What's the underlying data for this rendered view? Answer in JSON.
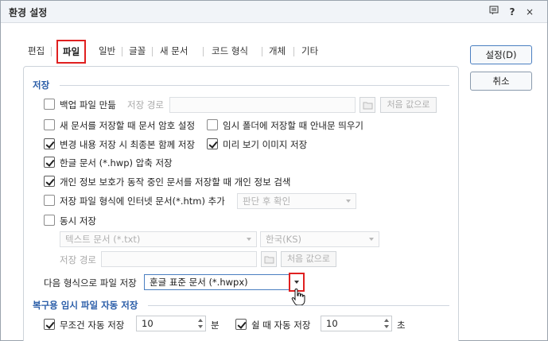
{
  "window": {
    "title": "환경 설정",
    "icons": [
      "help-panel-icon",
      "question-icon",
      "close-icon"
    ],
    "q": "?",
    "x": "×"
  },
  "tabs": [
    "편집",
    "파일",
    "일반",
    "글꼴",
    "새 문서",
    "코드 형식",
    "개체",
    "기타"
  ],
  "buttons": {
    "ok": "설정(D)",
    "cancel": "취소"
  },
  "save": {
    "group": "저장",
    "backup": "백업 파일 만듦",
    "save_path_label": "저장 경로",
    "default_value": "처음 값으로",
    "pwd_new_doc": "새 문서를 저장할 때 문서 암호 설정",
    "temp_folder_notice": "임시 폴더에 저장할 때 안내문 띄우기",
    "save_changes_only": "변경 내용 저장 시 최종본 함께 저장",
    "save_preview": "미리 보기 이미지 저장",
    "hwp_compress": "한글 문서 (*.hwp) 압축 저장",
    "privacy_check": "개인 정보 보호가 동작 중인 문서를 저장할 때 개인 정보 검색",
    "add_web_format": "저장 파일 형식에 인터넷 문서(*.htm) 추가",
    "add_web_format_select": "판단 후 확인",
    "sync_save": "동시 저장",
    "sync_format": "텍스트 문서 (*.txt)",
    "sync_encoding": "한국(KS)",
    "sync_path_label": "저장 경로",
    "sync_default": "처음 값으로",
    "save_as_label": "다음 형식으로 파일 저장",
    "save_as_value": "훈글 표준 문서 (*.hwpx)"
  },
  "recovery": {
    "group": "복구용 임시 파일 자동 저장",
    "always_label": "무조건 자동 저장",
    "always_value": "10",
    "always_unit": "분",
    "idle_label": "쉴 때 자동 저장",
    "idle_value": "10",
    "idle_unit": "초"
  },
  "checks": {
    "backup": false,
    "pwd_new_doc": false,
    "temp_folder_notice": false,
    "save_changes_only": true,
    "save_preview": true,
    "hwp_compress": true,
    "privacy_check": true,
    "add_web_format": false,
    "sync_save": false,
    "always": true,
    "idle": true
  }
}
